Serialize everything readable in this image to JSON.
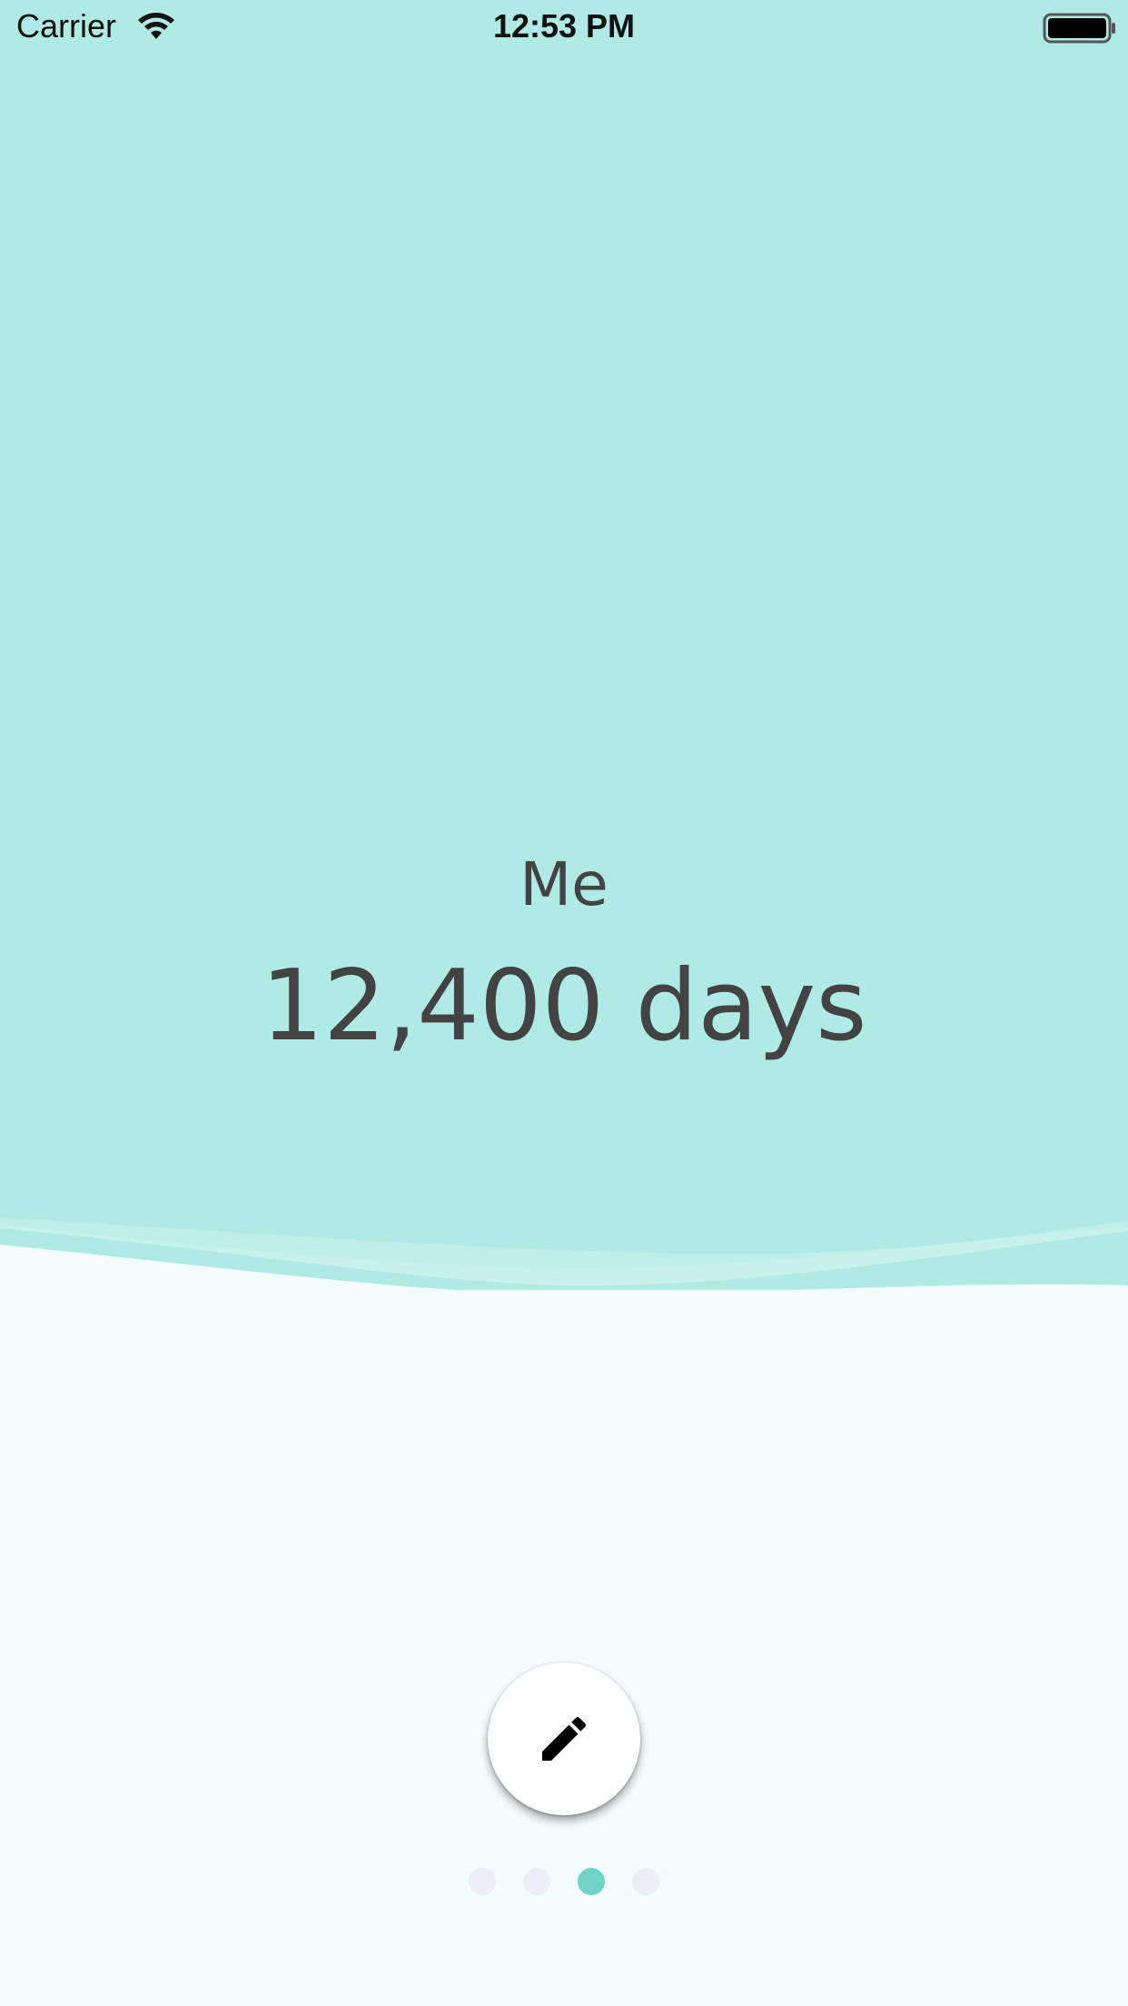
{
  "status_bar": {
    "carrier": "Carrier",
    "time": "12:53 PM",
    "wifi_icon": "wifi-icon",
    "battery_icon": "battery-icon"
  },
  "main": {
    "title": "Me",
    "days": "12,400 days"
  },
  "edit_button": {
    "icon": "pencil-icon"
  },
  "pager": {
    "count": 4,
    "active_index": 2
  },
  "colors": {
    "top_background": "#afebe4",
    "bottom_background": "#f4fdfd",
    "text": "#434343",
    "active_dot": "#6fd4c6",
    "inactive_dot": "#eeeef8"
  }
}
